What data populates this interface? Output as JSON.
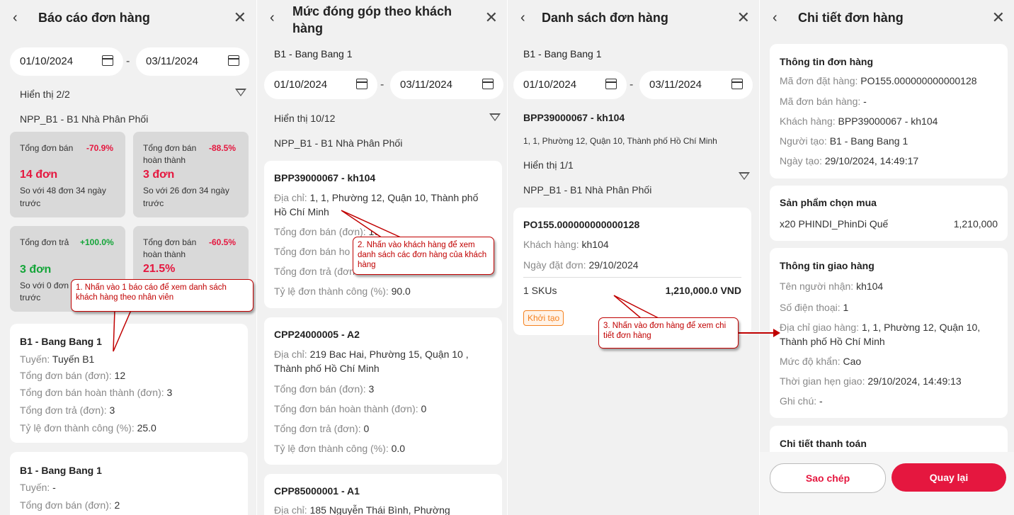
{
  "p1": {
    "title": "Báo cáo đơn hàng",
    "date_from": "01/10/2024",
    "date_to": "03/11/2024",
    "display": "Hiển thị 2/2",
    "distributor": "NPP_B1 - B1 Nhà Phân Phối",
    "stats": [
      {
        "label": "Tổng đơn bán",
        "pct": "-70.9%",
        "value": "14 đơn",
        "sub": "So với 48 đơn 34 ngày trước"
      },
      {
        "label": "Tổng đơn bán hoàn thành",
        "pct": "-88.5%",
        "value": "3 đơn",
        "sub": "So với 26 đơn 34 ngày trước"
      },
      {
        "label": "Tổng đơn trả",
        "pct": "+100.0%",
        "value": "3 đơn",
        "sub": "So với 0 đơn",
        "sub2": "trước"
      },
      {
        "label": "Tổng đơn bán hoàn thành",
        "pct": "-60.5%",
        "value": "21.5%"
      }
    ],
    "cards": [
      {
        "name": "B1 - Bang Bang 1",
        "rows": [
          {
            "k": "Tuyến: ",
            "v": "Tuyến B1"
          },
          {
            "k": "Tổng đơn bán (đơn): ",
            "v": "12"
          },
          {
            "k": "Tổng đơn bán hoàn thành (đơn): ",
            "v": "3"
          },
          {
            "k": "Tổng đơn trả (đơn): ",
            "v": "3"
          },
          {
            "k": "Tỷ lệ đơn thành công (%): ",
            "v": "25.0"
          }
        ]
      },
      {
        "name": "B1 - Bang Bang 1",
        "rows": [
          {
            "k": "Tuyến: ",
            "v": "-"
          },
          {
            "k": "Tổng đơn bán (đơn): ",
            "v": "2"
          }
        ]
      }
    ],
    "callout": "1. Nhấn vào 1 báo cáo để xem danh sách khách hàng theo nhân viên"
  },
  "p2": {
    "title": "Mức đóng góp theo khách hàng",
    "seller": "B1 - Bang Bang 1",
    "date_from": "01/10/2024",
    "date_to": "03/11/2024",
    "display": "Hiển thị 10/12",
    "distributor": "NPP_B1 - B1 Nhà Phân Phối",
    "cards": [
      {
        "name": "BPP39000067 - kh104",
        "address_k": "Địa chỉ: ",
        "address": "1, 1, Phường 12, Quận 10, Thành phố Hồ Chí Minh",
        "rows": [
          {
            "k": "Tổng đơn bán (đơn): ",
            "v": "10"
          },
          {
            "k": "Tổng đơn bán ho",
            "v": ""
          },
          {
            "k": "Tổng đơn trả (đơn",
            "v": ""
          },
          {
            "k": "Tỷ lệ đơn thành công (%): ",
            "v": "90.0"
          }
        ]
      },
      {
        "name": "CPP24000005 - A2",
        "address_k": "Địa chỉ: ",
        "address": "219 Bac Hai, Phường 15, Quận 10 , Thành phố Hồ Chí Minh",
        "rows": [
          {
            "k": "Tổng đơn bán (đơn): ",
            "v": "3"
          },
          {
            "k": "Tổng đơn bán hoàn thành (đơn): ",
            "v": "0"
          },
          {
            "k": "Tổng đơn trả (đơn): ",
            "v": "0"
          },
          {
            "k": "Tỷ lệ đơn thành công (%): ",
            "v": "0.0"
          }
        ]
      },
      {
        "name": "CPP85000001 - A1",
        "address_k": "Địa chỉ: ",
        "address": "185 Nguyễn Thái Bình, Phường"
      }
    ],
    "callout": "2. Nhấn vào khách hàng để xem danh sách các đơn hàng của khách hàng"
  },
  "p3": {
    "title": "Danh sách đơn hàng",
    "seller": "B1 - Bang Bang 1",
    "date_from": "01/10/2024",
    "date_to": "03/11/2024",
    "customer": "BPP39000067 - kh104",
    "address": "1, 1, Phường 12, Quận 10, Thành phố Hồ Chí Minh",
    "display": "Hiển thị 1/1",
    "distributor": "NPP_B1 - B1 Nhà Phân Phối",
    "order": {
      "code": "PO155.000000000000128",
      "customer_k": "Khách hàng: ",
      "customer": "kh104",
      "date_k": "Ngày đặt đơn: ",
      "date": "29/10/2024",
      "skus": "1 SKUs",
      "amount": "1,210,000.0 VND",
      "status": "Khởi tạo"
    },
    "callout": "3. Nhấn vào đơn hàng để xem chi tiết đơn hàng"
  },
  "p4": {
    "title": "Chi tiết đơn hàng",
    "info_title": "Thông tin đơn hàng",
    "info": [
      {
        "k": "Mã đơn đặt hàng: ",
        "v": "PO155.000000000000128"
      },
      {
        "k": "Mã đơn bán hàng: ",
        "v": "-"
      },
      {
        "k": "Khách hàng: ",
        "v": "BPP39000067 - kh104"
      },
      {
        "k": "Người tạo: ",
        "v": "B1 - Bang Bang 1"
      },
      {
        "k": "Ngày tạo: ",
        "v": "29/10/2024, 14:49:17"
      }
    ],
    "product_title": "Sản phẩm chọn mua",
    "product": {
      "name": "x20 PHINDI_PhinDi Quế",
      "price": "1,210,000"
    },
    "ship_title": "Thông tin giao hàng",
    "ship": [
      {
        "k": "Tên người nhận: ",
        "v": "kh104"
      },
      {
        "k": "Số điện thoại: ",
        "v": "1"
      },
      {
        "k": "Địa chỉ giao hàng: ",
        "v": "1, 1, Phường 12, Quận 10, Thành phố Hồ Chí Minh"
      },
      {
        "k": "Mức độ khẩn: ",
        "v": "Cao"
      },
      {
        "k": "Thời gian hẹn giao: ",
        "v": "29/10/2024, 14:49:13"
      },
      {
        "k": "Ghi chú: ",
        "v": "-"
      }
    ],
    "pay_title": "Chi tiết thanh toán",
    "copy_button": "Sao chép",
    "back_button": "Quay lại"
  },
  "icons": {
    "back": "chevron-left-icon",
    "close": "close-icon",
    "calendar": "calendar-icon",
    "filter": "filter-icon"
  },
  "colors": {
    "accent": "#e5173f",
    "positive": "#13a538",
    "status": "#f58220",
    "callout": "#c00000"
  }
}
